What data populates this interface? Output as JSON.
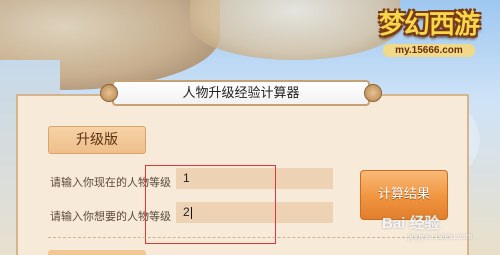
{
  "logo": {
    "title": "梦幻西游",
    "url": "my.15666.com"
  },
  "calculator": {
    "title": "人物升级经验计算器",
    "version_label": "升级版",
    "current_level_label": "请输入你现在的人物等级",
    "current_level_value": "1",
    "target_level_label": "请输入你想要的人物等级",
    "target_level_value": "2",
    "calc_button_label": "计算结果"
  },
  "watermark": {
    "text": "Bai 经验",
    "sub": "jingyan.baidu.com"
  },
  "colors": {
    "panel_bg": "#f7ead9",
    "input_bg": "#edd3b4",
    "button_orange": "#f0943f",
    "highlight_red": "#e03838"
  }
}
